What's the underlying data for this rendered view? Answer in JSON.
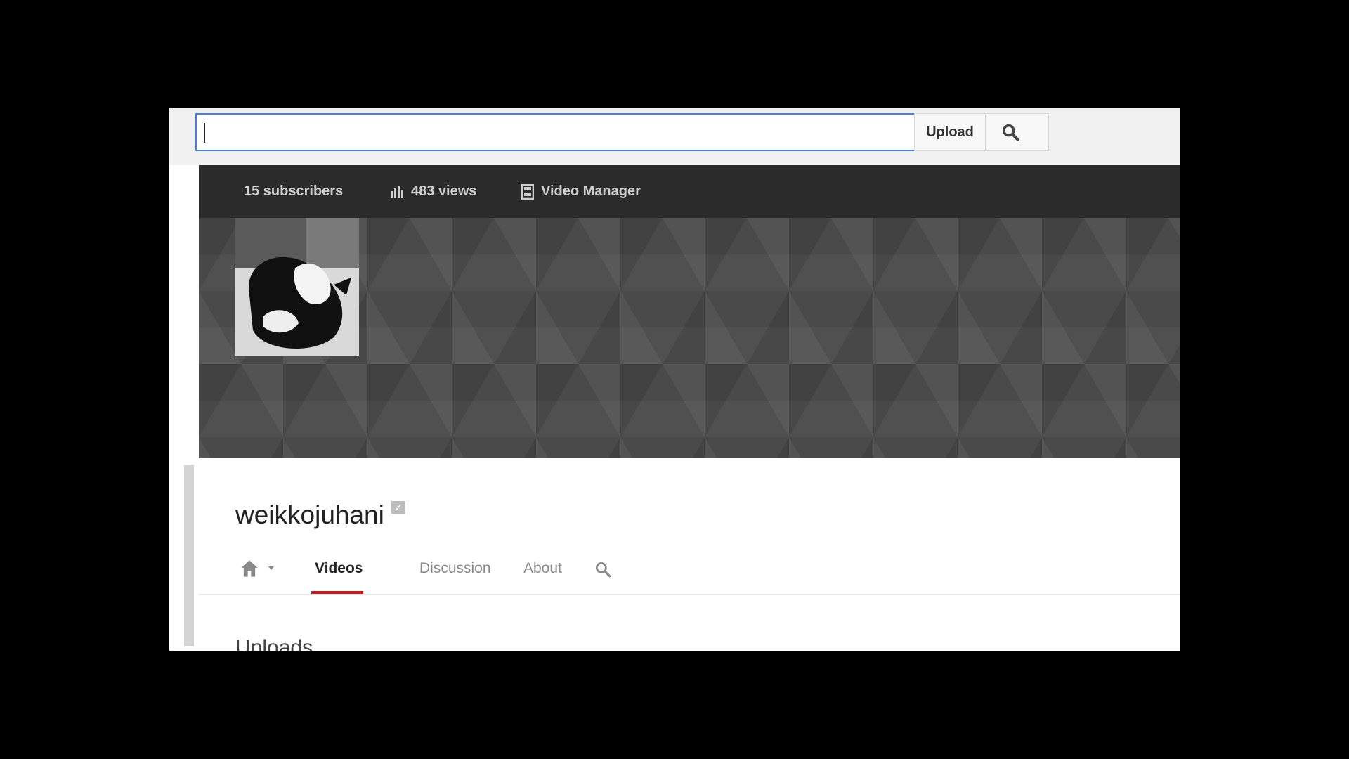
{
  "header": {
    "search": {
      "value": "",
      "placeholder": ""
    },
    "upload_label": "Upload"
  },
  "stats": {
    "subscribers": "15 subscribers",
    "views": "483 views",
    "video_manager": "Video Manager"
  },
  "channel": {
    "name": "weikkojuhani"
  },
  "tabs": [
    {
      "label": "Videos",
      "active": true
    },
    {
      "label": "Discussion",
      "active": false
    },
    {
      "label": "About",
      "active": false
    }
  ],
  "section": {
    "uploads_title": "Uploads"
  },
  "colors": {
    "search_border": "#4d7edb",
    "stats_bar": "#2b2b2b",
    "active_tab_underline": "#cc181e"
  }
}
